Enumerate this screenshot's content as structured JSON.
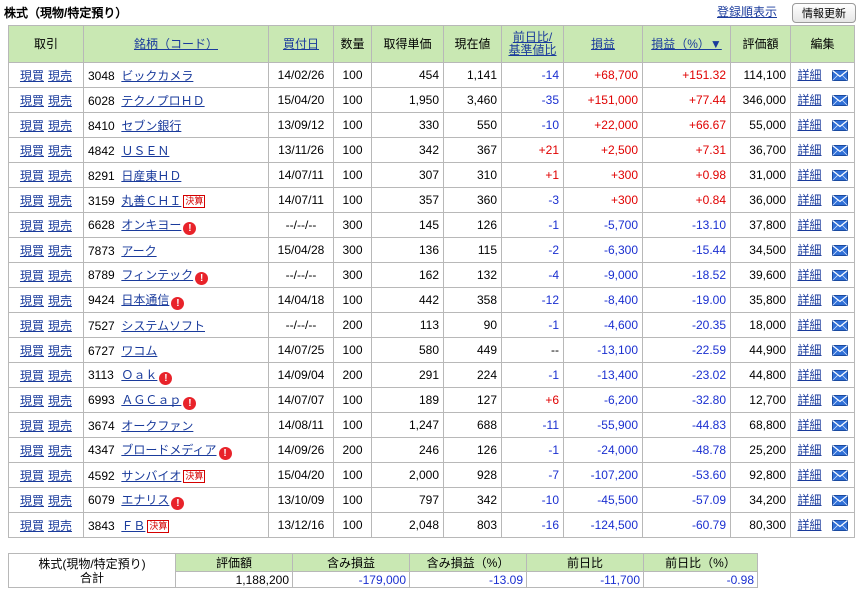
{
  "header": {
    "title": "株式（現物/特定預り）",
    "sort_link": "登録順表示",
    "refresh_button": "情報更新"
  },
  "table": {
    "columns": {
      "trade": "取引",
      "name": "銘柄（コード）",
      "date": "買付日",
      "qty": "数量",
      "cost": "取得単価",
      "price": "現在値",
      "change_l1": "前日比/",
      "change_l2": "基準値比",
      "pl": "損益",
      "plpct": "損益（%）▼",
      "value": "評価額",
      "edit": "編集"
    },
    "buy_label": "現買",
    "sell_label": "現売",
    "detail_label": "詳細",
    "kessan_label": "決算",
    "alert_label": "!",
    "rows": [
      {
        "code": "3048",
        "name": "ビックカメラ",
        "alert": false,
        "kessan": false,
        "date": "14/02/26",
        "qty": "100",
        "cost": "454",
        "price": "1,141",
        "change": "-14",
        "pl": "+68,700",
        "plpct": "+151.32",
        "value": "114,100"
      },
      {
        "code": "6028",
        "name": "テクノプロＨＤ",
        "alert": false,
        "kessan": false,
        "date": "15/04/20",
        "qty": "100",
        "cost": "1,950",
        "price": "3,460",
        "change": "-35",
        "pl": "+151,000",
        "plpct": "+77.44",
        "value": "346,000"
      },
      {
        "code": "8410",
        "name": "セブン銀行",
        "alert": false,
        "kessan": false,
        "date": "13/09/12",
        "qty": "100",
        "cost": "330",
        "price": "550",
        "change": "-10",
        "pl": "+22,000",
        "plpct": "+66.67",
        "value": "55,000"
      },
      {
        "code": "4842",
        "name": "ＵＳＥＮ",
        "alert": false,
        "kessan": false,
        "date": "13/11/26",
        "qty": "100",
        "cost": "342",
        "price": "367",
        "change": "+21",
        "pl": "+2,500",
        "plpct": "+7.31",
        "value": "36,700"
      },
      {
        "code": "8291",
        "name": "日産東ＨＤ",
        "alert": false,
        "kessan": false,
        "date": "14/07/11",
        "qty": "100",
        "cost": "307",
        "price": "310",
        "change": "+1",
        "pl": "+300",
        "plpct": "+0.98",
        "value": "31,000"
      },
      {
        "code": "3159",
        "name": "丸善ＣＨＩ",
        "alert": false,
        "kessan": true,
        "date": "14/07/11",
        "qty": "100",
        "cost": "357",
        "price": "360",
        "change": "-3",
        "pl": "+300",
        "plpct": "+0.84",
        "value": "36,000"
      },
      {
        "code": "6628",
        "name": "オンキヨー",
        "alert": true,
        "kessan": false,
        "date": "--/--/--",
        "qty": "300",
        "cost": "145",
        "price": "126",
        "change": "-1",
        "pl": "-5,700",
        "plpct": "-13.10",
        "value": "37,800"
      },
      {
        "code": "7873",
        "name": "アーク",
        "alert": false,
        "kessan": false,
        "date": "15/04/28",
        "qty": "300",
        "cost": "136",
        "price": "115",
        "change": "-2",
        "pl": "-6,300",
        "plpct": "-15.44",
        "value": "34,500"
      },
      {
        "code": "8789",
        "name": "フィンテック",
        "alert": true,
        "kessan": false,
        "date": "--/--/--",
        "qty": "300",
        "cost": "162",
        "price": "132",
        "change": "-4",
        "pl": "-9,000",
        "plpct": "-18.52",
        "value": "39,600"
      },
      {
        "code": "9424",
        "name": "日本通信",
        "alert": true,
        "kessan": false,
        "date": "14/04/18",
        "qty": "100",
        "cost": "442",
        "price": "358",
        "change": "-12",
        "pl": "-8,400",
        "plpct": "-19.00",
        "value": "35,800"
      },
      {
        "code": "7527",
        "name": "システムソフト",
        "alert": false,
        "kessan": false,
        "date": "--/--/--",
        "qty": "200",
        "cost": "113",
        "price": "90",
        "change": "-1",
        "pl": "-4,600",
        "plpct": "-20.35",
        "value": "18,000"
      },
      {
        "code": "6727",
        "name": "ワコム",
        "alert": false,
        "kessan": false,
        "date": "14/07/25",
        "qty": "100",
        "cost": "580",
        "price": "449",
        "change": "--",
        "pl": "-13,100",
        "plpct": "-22.59",
        "value": "44,900"
      },
      {
        "code": "3113",
        "name": "Ｏａｋ",
        "alert": true,
        "kessan": false,
        "date": "14/09/04",
        "qty": "200",
        "cost": "291",
        "price": "224",
        "change": "-1",
        "pl": "-13,400",
        "plpct": "-23.02",
        "value": "44,800"
      },
      {
        "code": "6993",
        "name": "ＡＧＣａｐ",
        "alert": true,
        "kessan": false,
        "date": "14/07/07",
        "qty": "100",
        "cost": "189",
        "price": "127",
        "change": "+6",
        "pl": "-6,200",
        "plpct": "-32.80",
        "value": "12,700"
      },
      {
        "code": "3674",
        "name": "オークファン",
        "alert": false,
        "kessan": false,
        "date": "14/08/11",
        "qty": "100",
        "cost": "1,247",
        "price": "688",
        "change": "-11",
        "pl": "-55,900",
        "plpct": "-44.83",
        "value": "68,800"
      },
      {
        "code": "4347",
        "name": "ブロードメディア",
        "alert": true,
        "kessan": false,
        "date": "14/09/26",
        "qty": "200",
        "cost": "246",
        "price": "126",
        "change": "-1",
        "pl": "-24,000",
        "plpct": "-48.78",
        "value": "25,200"
      },
      {
        "code": "4592",
        "name": "サンバイオ",
        "alert": false,
        "kessan": true,
        "date": "15/04/20",
        "qty": "100",
        "cost": "2,000",
        "price": "928",
        "change": "-7",
        "pl": "-107,200",
        "plpct": "-53.60",
        "value": "92,800"
      },
      {
        "code": "6079",
        "name": "エナリス",
        "alert": true,
        "kessan": false,
        "date": "13/10/09",
        "qty": "100",
        "cost": "797",
        "price": "342",
        "change": "-10",
        "pl": "-45,500",
        "plpct": "-57.09",
        "value": "34,200"
      },
      {
        "code": "3843",
        "name": "ＦＢ",
        "alert": false,
        "kessan": true,
        "date": "13/12/16",
        "qty": "100",
        "cost": "2,048",
        "price": "803",
        "change": "-16",
        "pl": "-124,500",
        "plpct": "-60.79",
        "value": "80,300"
      }
    ]
  },
  "summary": {
    "label_l1": "株式(現物/特定預り)",
    "label_l2": "合計",
    "headers": [
      "評価額",
      "含み損益",
      "含み損益（%）",
      "前日比",
      "前日比（%）"
    ],
    "values": [
      "1,188,200",
      "-179,000",
      "-13.09",
      "-11,700",
      "-0.98"
    ]
  },
  "colors": {
    "header_bg": "#c9e8b3",
    "positive": "#e00000",
    "negative": "#1a2fd0",
    "link": "#1a3b9c"
  }
}
